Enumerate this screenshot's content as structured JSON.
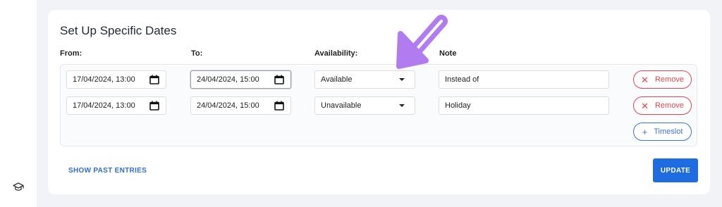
{
  "sidebar": {
    "icon": "graduation-cap-icon"
  },
  "card": {
    "title": "Set Up Specific Dates",
    "columns": {
      "from": "From:",
      "to": "To:",
      "availability": "Availability:",
      "note": "Note"
    }
  },
  "rows": [
    {
      "from": "17/04/2024, 13:00",
      "to": "24/04/2024, 15:00",
      "availability": "Available",
      "note": "Instead of",
      "remove_label": "Remove"
    },
    {
      "from": "17/04/2024, 13:00",
      "to": "24/04/2024, 15:00",
      "availability": "Unavailable",
      "note": "Holiday",
      "remove_label": "Remove"
    }
  ],
  "timeslot_label": "Timeslot",
  "past_entries_label": "SHOW PAST ENTRIES",
  "update_label": "UPDATE",
  "colors": {
    "accent": "#1e6ce0",
    "danger": "#e2474f",
    "annotation_arrow": "#b07cf0"
  }
}
